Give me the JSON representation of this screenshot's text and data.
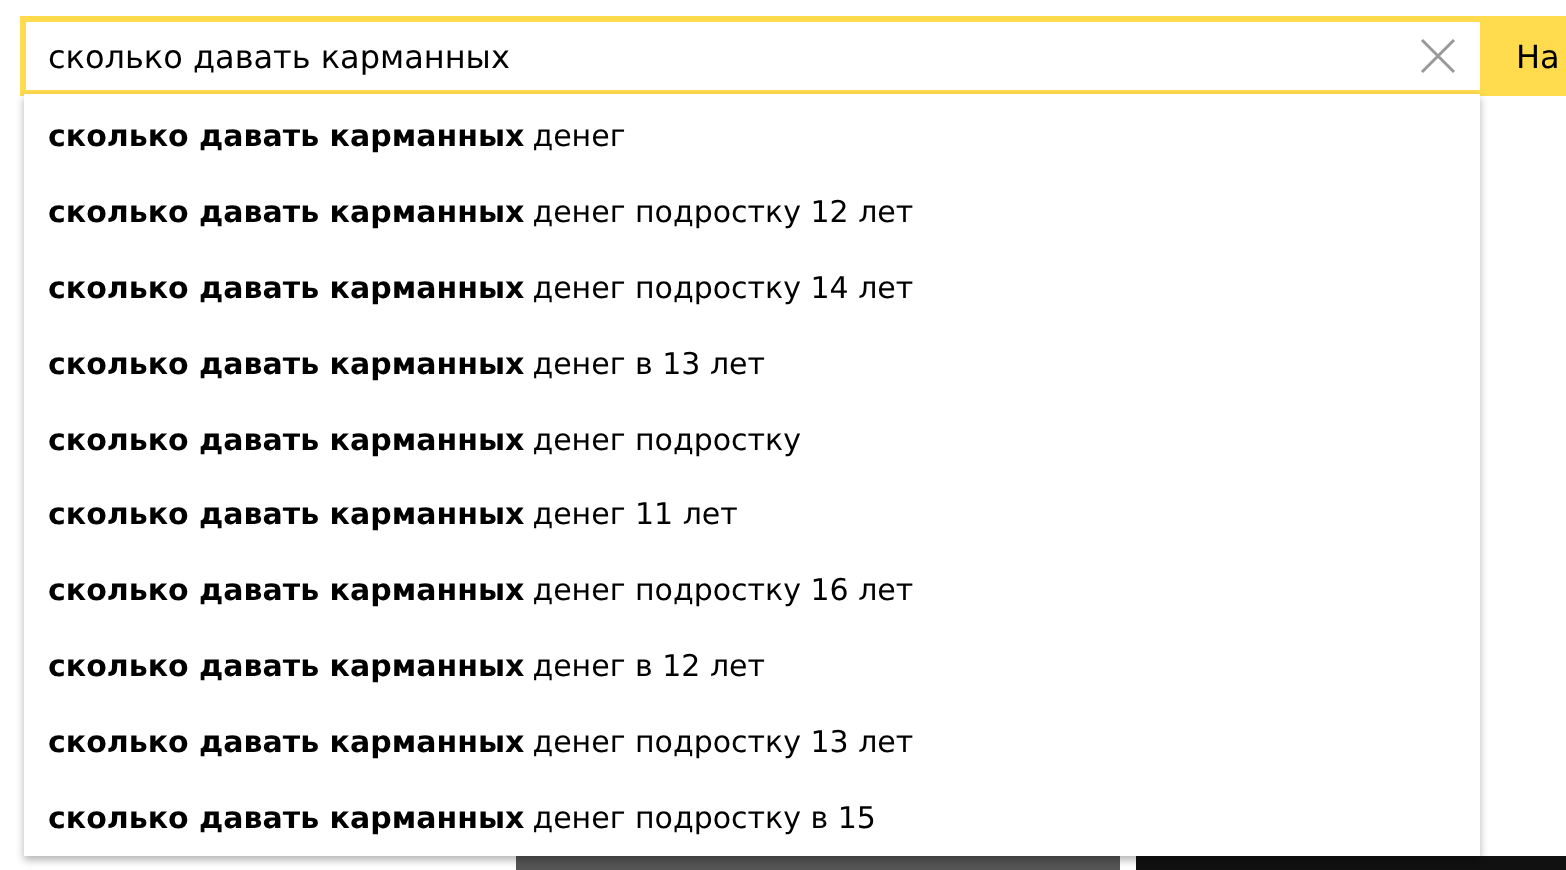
{
  "search": {
    "value": "сколько давать карманных ",
    "button": "На"
  },
  "suggestions": [
    "**сколько давать карманных** денег",
    "**сколько давать карманных** денег подростку 12 лет",
    "**сколько давать карманных** денег подростку 14 лет",
    "**сколько давать карманных** денег в 13 лет",
    "**сколько давать карманных** денег подростку",
    "**сколько давать карманных** денег 11 лет",
    "**сколько давать карманных** денег подростку 16 лет",
    "**сколько давать карманных** денег в 12 лет",
    "**сколько давать карманных** денег подростку 13 лет",
    "**сколько давать карманных** денег подростку в 15"
  ]
}
